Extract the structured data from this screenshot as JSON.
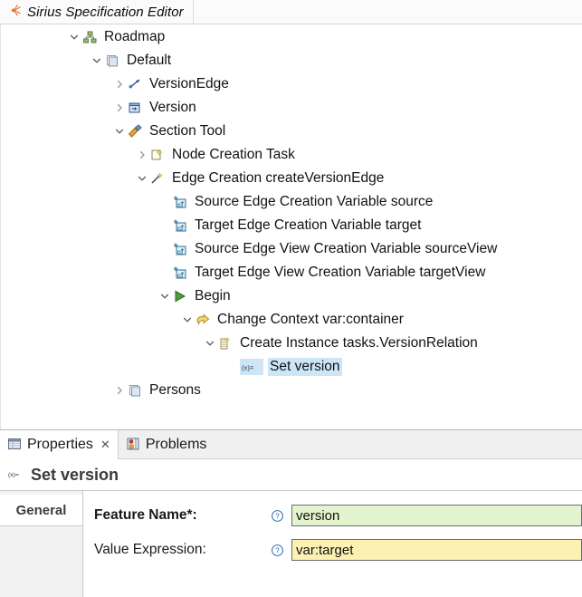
{
  "editor": {
    "tab_title": "Sirius Specification Editor",
    "tab_icon": "sirius-icon"
  },
  "tree": {
    "rows": [
      {
        "label": "Roadmap",
        "indent": 0,
        "twisty": "down",
        "icon": "viewpoint-icon"
      },
      {
        "label": "Default",
        "indent": 1,
        "twisty": "down",
        "icon": "diagram-description-icon"
      },
      {
        "label": "VersionEdge",
        "indent": 2,
        "twisty": "right",
        "icon": "edge-mapping-icon"
      },
      {
        "label": "Version",
        "indent": 2,
        "twisty": "right",
        "icon": "node-mapping-icon"
      },
      {
        "label": "Section Tool",
        "indent": 2,
        "twisty": "down",
        "icon": "tool-section-icon"
      },
      {
        "label": "Node Creation Task",
        "indent": 3,
        "twisty": "right",
        "icon": "node-creation-icon"
      },
      {
        "label": "Edge Creation createVersionEdge",
        "indent": 3,
        "twisty": "down",
        "icon": "edge-creation-icon"
      },
      {
        "label": "Source Edge Creation Variable source",
        "indent": 4,
        "twisty": "none",
        "icon": "variable-icon"
      },
      {
        "label": "Target Edge Creation Variable target",
        "indent": 4,
        "twisty": "none",
        "icon": "variable-icon"
      },
      {
        "label": "Source Edge View Creation Variable sourceView",
        "indent": 4,
        "twisty": "none",
        "icon": "variable-icon"
      },
      {
        "label": "Target Edge View Creation Variable targetView",
        "indent": 4,
        "twisty": "none",
        "icon": "variable-icon"
      },
      {
        "label": "Begin",
        "indent": 4,
        "twisty": "down",
        "icon": "begin-icon"
      },
      {
        "label": "Change Context var:container",
        "indent": 5,
        "twisty": "down",
        "icon": "change-context-icon"
      },
      {
        "label": "Create Instance tasks.VersionRelation",
        "indent": 6,
        "twisty": "down",
        "icon": "create-instance-icon"
      },
      {
        "label": "Set version",
        "indent": 7,
        "twisty": "none",
        "icon": "set-value-icon",
        "selected": true
      },
      {
        "label": "Persons",
        "indent": 2,
        "twisty": "right",
        "icon": "diagram-description-icon"
      }
    ]
  },
  "properties_view": {
    "tabs": [
      {
        "label": "Properties",
        "icon": "properties-icon",
        "active": true,
        "closable": true
      },
      {
        "label": "Problems",
        "icon": "problems-icon",
        "active": false,
        "closable": false
      }
    ],
    "close_glyph": "✕",
    "header": {
      "title": "Set version",
      "icon": "set-value-icon"
    },
    "side_tabs": [
      {
        "label": "General",
        "active": true
      }
    ],
    "fields": [
      {
        "label": "Feature Name*:",
        "required": true,
        "help_icon": "help-icon",
        "value": "version",
        "style": "green"
      },
      {
        "label": "Value Expression:",
        "required": false,
        "help_icon": "help-icon",
        "value": "var:target",
        "style": "yellow"
      }
    ]
  },
  "colors": {
    "selection": "#cde6f7",
    "field_required_bg": "#e2f4cd",
    "field_expression_bg": "#fdf0b3",
    "accent_orange": "#e8722c"
  }
}
